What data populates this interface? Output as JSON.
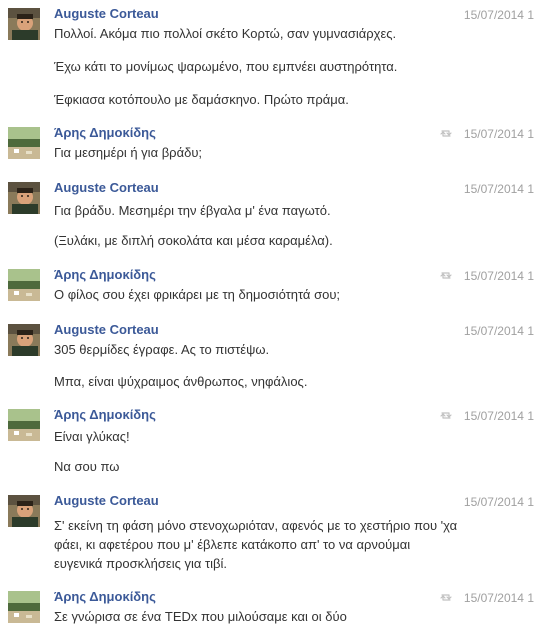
{
  "groups": [
    {
      "sender": "Auguste Corteau",
      "avatar": "auguste-avatar",
      "timestamp": "15/07/2014 1",
      "reply_icon": false,
      "messages": [
        "Πολλοί. Ακόμα πιο πολλοί σκέτο Κορτώ, σαν γυμνασιάρχες.",
        "Έχω κάτι το μονίμως ψαρωμένο, που εμπνέει αυστηρότητα.",
        "Έφκιασα κοτόπουλο με δαμάσκηνο. Πρώτο πράμα."
      ]
    },
    {
      "sender": "Άρης Δημοκίδης",
      "avatar": "aris-avatar",
      "timestamp": "15/07/2014 1",
      "reply_icon": true,
      "messages": [
        "Για μεσημέρι ή για βράδυ;"
      ]
    },
    {
      "sender": "Auguste Corteau",
      "avatar": "auguste-avatar",
      "timestamp": "15/07/2014 1",
      "reply_icon": false,
      "messages": [
        "Για βράδυ. Μεσημέρι την έβγαλα μ' ένα παγωτό.",
        "(Ξυλάκι, με διπλή σοκολάτα και μέσα καραμέλα)."
      ]
    },
    {
      "sender": "Άρης Δημοκίδης",
      "avatar": "aris-avatar",
      "timestamp": "15/07/2014 1",
      "reply_icon": true,
      "messages": [
        "Ο φίλος σου έχει φρικάρει με τη δημοσιότητά σου;"
      ]
    },
    {
      "sender": "Auguste Corteau",
      "avatar": "auguste-avatar",
      "timestamp": "15/07/2014 1",
      "reply_icon": false,
      "messages": [
        "305 θερμίδες έγραφε. Ας το πιστέψω.",
        "Μπα, είναι ψύχραιμος άνθρωπος, νηφάλιος."
      ]
    },
    {
      "sender": "Άρης Δημοκίδης",
      "avatar": "aris-avatar",
      "timestamp": "15/07/2014 1",
      "reply_icon": true,
      "messages": [
        "Είναι γλύκας!",
        "Να σου πω"
      ]
    },
    {
      "sender": "Auguste Corteau",
      "avatar": "auguste-avatar",
      "timestamp": "15/07/2014 1",
      "reply_icon": false,
      "messages": [
        "Σ' εκείνη τη φάση μόνο στενοχωριόταν, αφενός με το χεστήριο που 'χα",
        "φάει, κι αφετέρου που μ' έβλεπε κατάκοπο απ' το να αρνούμαι",
        "ευγενικά προσκλήσεις για τιβί."
      ]
    },
    {
      "sender": "Άρης Δημοκίδης",
      "avatar": "aris-avatar",
      "timestamp": "15/07/2014 1",
      "reply_icon": true,
      "messages": [
        "Σε γνώρισα σε ένα TEDx που μιλούσαμε και οι δύο"
      ]
    }
  ],
  "colors": {
    "sender": "#3b5998",
    "text": "#333333",
    "timestamp": "#a0a0a0"
  }
}
